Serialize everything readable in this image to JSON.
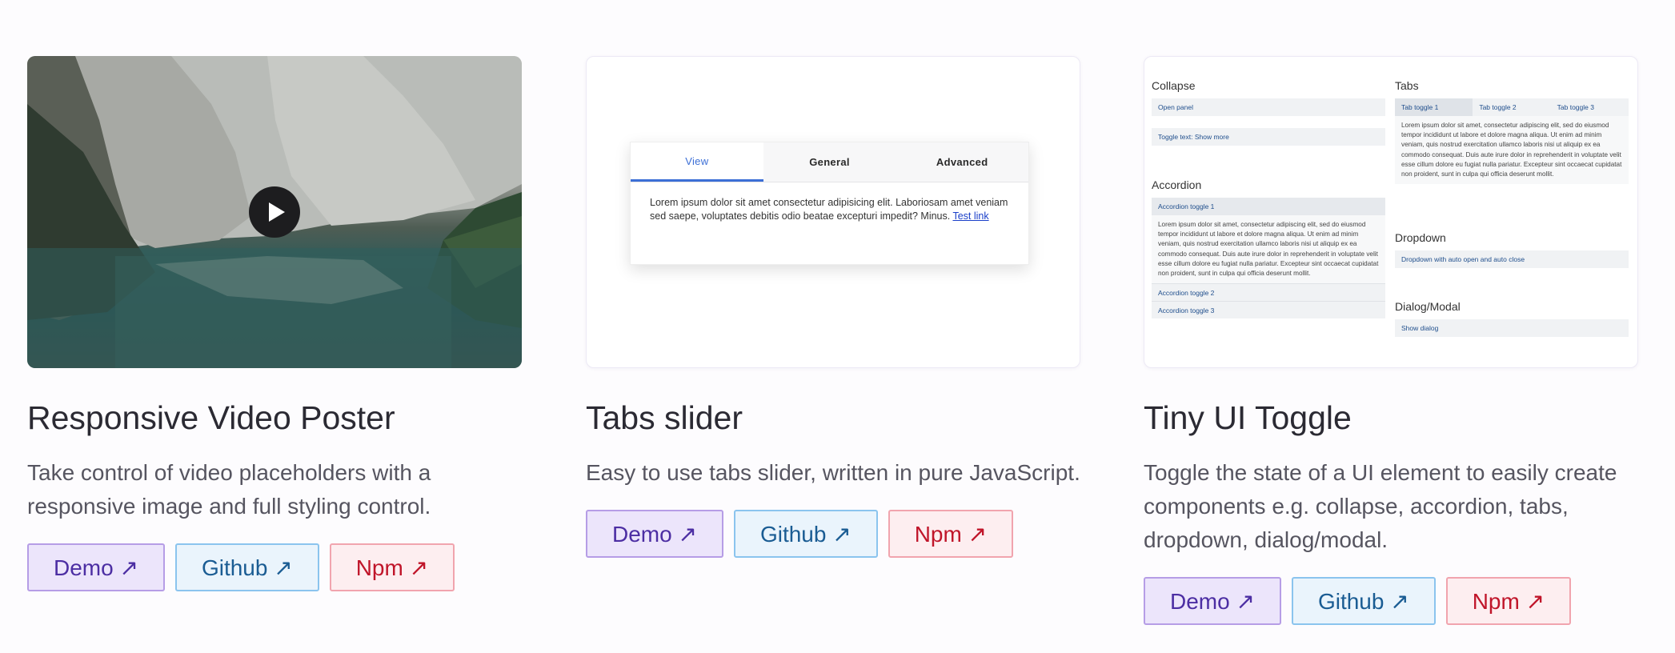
{
  "cards": [
    {
      "title": "Responsive Video Poster",
      "description": "Take control of video placeholders with a responsive image and full styling control.",
      "buttons": {
        "demo": "Demo ↗",
        "github": "Github ↗",
        "npm": "Npm ↗"
      }
    },
    {
      "title": "Tabs slider",
      "description": "Easy to use tabs slider, written in pure JavaScript.",
      "buttons": {
        "demo": "Demo ↗",
        "github": "Github ↗",
        "npm": "Npm ↗"
      },
      "preview": {
        "tabs": [
          "View",
          "General",
          "Advanced"
        ],
        "text": "Lorem ipsum dolor sit amet consectetur adipisicing elit. Laboriosam amet veniam sed saepe, voluptates debitis odio beatae excepturi impedit? Minus.",
        "link": "Test link"
      }
    },
    {
      "title": "Tiny UI Toggle",
      "description": "Toggle the state of a UI element to easily create components e.g. collapse, accordion, tabs, dropdown, dialog/modal.",
      "buttons": {
        "demo": "Demo ↗",
        "github": "Github ↗",
        "npm": "Npm ↗"
      },
      "preview": {
        "collapse_heading": "Collapse",
        "collapse_open": "Open panel",
        "collapse_toggle": "Toggle text: Show more",
        "accordion_heading": "Accordion",
        "accordion_toggles": [
          "Accordion toggle 1",
          "Accordion toggle 2",
          "Accordion toggle 3"
        ],
        "accordion_text": "Lorem ipsum dolor sit amet, consectetur adipiscing elit, sed do eiusmod tempor incididunt ut labore et dolore magna aliqua. Ut enim ad minim veniam, quis nostrud exercitation ullamco laboris nisi ut aliquip ex ea commodo consequat. Duis aute irure dolor in reprehenderit in voluptate velit esse cillum dolore eu fugiat nulla pariatur. Excepteur sint occaecat cupidatat non proident, sunt in culpa qui officia deserunt mollit.",
        "tabs_heading": "Tabs",
        "tabs": [
          "Tab toggle 1",
          "Tab toggle 2",
          "Tab toggle 3"
        ],
        "tabs_text": "Lorem ipsum dolor sit amet, consectetur adipiscing elit, sed do eiusmod tempor incididunt ut labore et dolore magna aliqua. Ut enim ad minim veniam, quis nostrud exercitation ullamco laboris nisi ut aliquip ex ea commodo consequat. Duis aute irure dolor in reprehenderit in voluptate velit esse cillum dolore eu fugiat nulla pariatur. Excepteur sint occaecat cupidatat non proident, sunt in culpa qui officia deserunt mollit.",
        "dropdown_heading": "Dropdown",
        "dropdown_label": "Dropdown with auto open and auto close",
        "dialog_heading": "Dialog/Modal",
        "dialog_label": "Show dialog"
      }
    }
  ],
  "colors": {
    "demo_bg": "#ece5fb",
    "github_bg": "#eaf4fc",
    "npm_bg": "#fdeef0",
    "tab_active": "#3c6fd6"
  }
}
